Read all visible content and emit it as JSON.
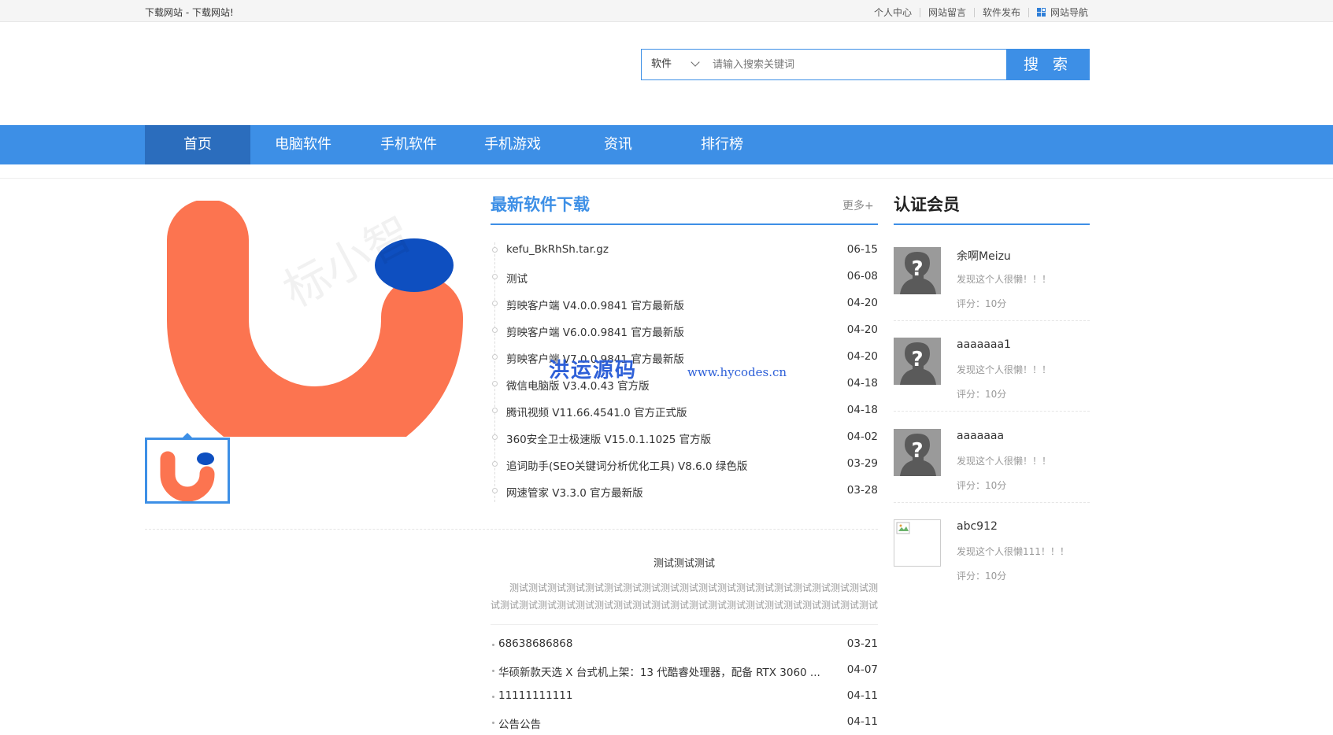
{
  "topbar": {
    "site_title": "下载网站 - 下载网站!",
    "links": [
      "个人中心",
      "网站留言",
      "软件发布",
      "网站导航"
    ]
  },
  "search": {
    "category": "软件",
    "placeholder": "请输入搜索关键词",
    "button": "搜 索"
  },
  "nav": {
    "items": [
      "首页",
      "电脑软件",
      "手机软件",
      "手机游戏",
      "资讯",
      "排行榜"
    ],
    "active": "首页"
  },
  "latest": {
    "title": "最新软件下载",
    "more": "更多+",
    "items": [
      {
        "title": "kefu_BkRhSh.tar.gz",
        "date": "06-15"
      },
      {
        "title": "测试",
        "date": "06-08"
      },
      {
        "title": "剪映客户端 V4.0.0.9841 官方最新版",
        "date": "04-20"
      },
      {
        "title": "剪映客户端 V6.0.0.9841 官方最新版",
        "date": "04-20"
      },
      {
        "title": "剪映客户端 V7.0.0.9841 官方最新版",
        "date": "04-20"
      },
      {
        "title": "微信电脑版 V3.4.0.43 官方版",
        "date": "04-18"
      },
      {
        "title": "腾讯视频 V11.66.4541.0 官方正式版",
        "date": "04-18"
      },
      {
        "title": "360安全卫士极速版 V15.0.1.1025 官方版",
        "date": "04-02"
      },
      {
        "title": "追词助手(SEO关键词分析优化工具) V8.6.0 绿色版",
        "date": "03-29"
      },
      {
        "title": "网速管家 V3.3.0 官方最新版",
        "date": "03-28"
      }
    ]
  },
  "notice": {
    "title": "测试测试测试",
    "body": "测试测试测试测试测试测试测试测试测试测试测试测试测试测试测试测试测试测试测试测试测试测试测试测试测试测试测试测试测试测试测试测试测试测试测试测试测试测试测试测试测试测试测试",
    "items": [
      {
        "title": "68638686868",
        "date": "03-21"
      },
      {
        "title": "华硕新款天选 X 台式机上架：13 代酷睿处理器，配备 RTX 3060 ...",
        "date": "04-07"
      },
      {
        "title": "11111111111",
        "date": "04-11"
      },
      {
        "title": "公告公告",
        "date": "04-11"
      }
    ]
  },
  "members": {
    "title": "认证会员",
    "items": [
      {
        "name": "余啊Meizu",
        "desc": "发现这个人很懒！！！",
        "score": "评分：10分",
        "avatar": "unknown-person-icon"
      },
      {
        "name": "aaaaaaa1",
        "desc": "发现这个人很懒！！！",
        "score": "评分：10分",
        "avatar": "unknown-person-icon"
      },
      {
        "name": "aaaaaaa",
        "desc": "发现这个人很懒！！！",
        "score": "评分：10分",
        "avatar": "unknown-person-icon"
      },
      {
        "name": "abc912",
        "desc": "发现这个人很懒111！！！",
        "score": "评分：10分",
        "avatar": "broken-image-icon"
      }
    ]
  },
  "watermark": {
    "cn": "洪运源码",
    "url": "www.hycodes.cn"
  },
  "colors": {
    "brand": "#3d8fe6",
    "nav_active": "#2b6dbd",
    "logo_orange": "#fc7450",
    "logo_blue": "#0e4fc0"
  }
}
